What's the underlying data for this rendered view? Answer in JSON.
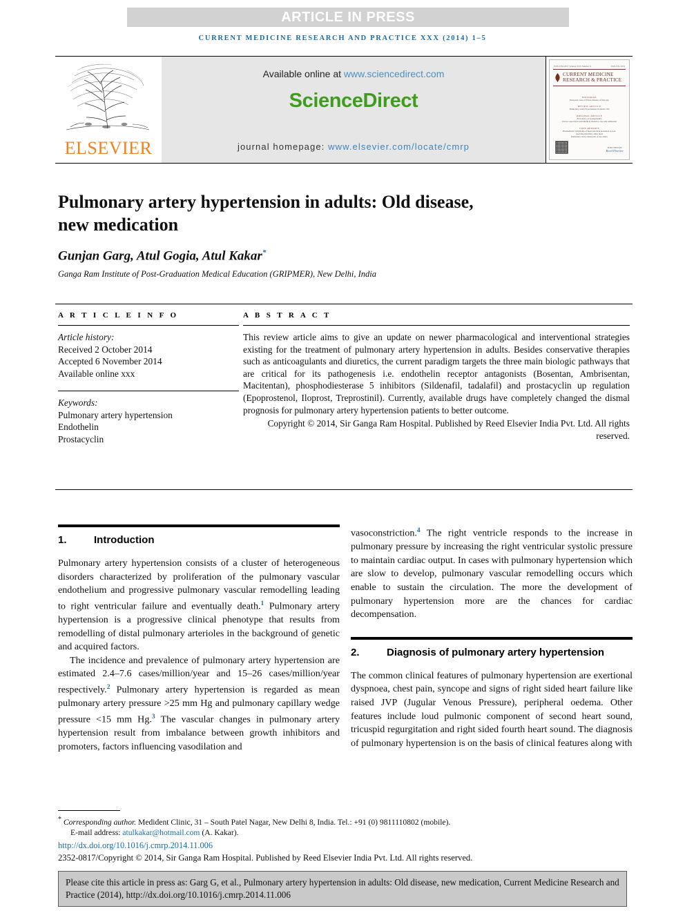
{
  "banner": {
    "article_in_press": "ARTICLE IN PRESS"
  },
  "running_head": "CURRENT MEDICINE RESEARCH AND PRACTICE XXX (2014) 1–5",
  "masthead": {
    "publisher_logo_text": "ELSEVIER",
    "available_prefix": "Available online at ",
    "available_url": "www.sciencedirect.com",
    "sciencedirect_logo": "ScienceDirect",
    "homepage_prefix": "journal homepage: ",
    "homepage_url": "www.elsevier.com/locate/cmrp",
    "cover": {
      "issn_left": "ISSN 2352-0817  Volume XXX  Number X",
      "issn_right": "XXX-XX, 2014",
      "title_line1": "CURRENT MEDICINE",
      "title_line2": "RESEARCH & PRACTICE",
      "imprint_label": "SGRH",
      "sections": [
        {
          "heading": "EDITORIAL",
          "lines": [
            "European cases of Ebola disease: A first step"
          ]
        },
        {
          "heading": "REVIEW ARTICLE",
          "lines": [
            "Pulmonary artery hypertension in adults: Old"
          ]
        },
        {
          "heading": "ORIGINAL ARTICLE",
          "lines": [
            "Prevalence of dyslipidaemia",
            "Factors associated with MDR in intensive care unit admission"
          ]
        },
        {
          "heading": "CASE REPORTS",
          "lines": [
            "Plasmablastic lymphoma of head and neck presented as non-",
            "resolving maxillary sinus mass",
            "Pulmonary artery aneurysm: A rare entity"
          ]
        }
      ],
      "publisher_small": "PUBLISHED BY",
      "publisher_name": "Reed Elsevier"
    }
  },
  "article": {
    "title": "Pulmonary artery hypertension in adults: Old disease, new medication",
    "authors": "Gunjan Garg, Atul Gogia, Atul Kakar",
    "author_marker": "*",
    "affiliation": "Ganga Ram Institute of Post-Graduation Medical Education (GRIPMER), New Delhi, India"
  },
  "article_info": {
    "label": "A R T I C L E   I N F O",
    "history_label": "Article history:",
    "history": [
      "Received 2 October 2014",
      "Accepted 6 November 2014",
      "Available online xxx"
    ],
    "keywords_label": "Keywords:",
    "keywords": [
      "Pulmonary artery hypertension",
      "Endothelin",
      "Prostacyclin"
    ]
  },
  "abstract": {
    "label": "A B S T R A C T",
    "body": "This review article aims to give an update on newer pharmacological and interventional strategies existing for the treatment of pulmonary artery hypertension in adults. Besides conservative therapies such as anticoagulants and diuretics, the current paradigm targets the three main biologic pathways that are critical for its pathogenesis i.e. endothelin receptor antagonists (Bosentan, Ambrisentan, Macitentan), phosphodiesterase 5 inhibitors (Sildenafil, tadalafil) and prostacyclin up regulation (Epoprostenol, Iloprost, Treprostinil). Currently, available drugs have completely changed the dismal prognosis for pulmonary artery hypertension patients to better outcome.",
    "copyright": "Copyright © 2014, Sir Ganga Ram Hospital. Published by Reed Elsevier India Pvt. Ltd. All rights reserved."
  },
  "sections": {
    "introduction": {
      "number": "1.",
      "title": "Introduction",
      "p1_a": "Pulmonary artery hypertension consists of a cluster of heterogeneous disorders characterized by proliferation of the pulmonary vascular endothelium and progressive pulmonary vascular remodelling leading to right ventricular failure and eventually death.",
      "p1_ref": "1",
      "p1_b": " Pulmonary artery hypertension is a progressive clinical phenotype that results from remodelling of distal pulmonary arterioles in the background of genetic and acquired factors.",
      "p2_a": "The incidence and prevalence of pulmonary artery hypertension are estimated 2.4–7.6 cases/million/year and 15–26 cases/million/year respectively.",
      "p2_ref": "2",
      "p2_b": " Pulmonary artery hypertension is regarded as mean pulmonary artery pressure >25 mm Hg and pulmonary capillary wedge pressure <15 mm Hg.",
      "p2_ref2": "3",
      "p2_c": " The vascular changes in pulmonary artery hypertension result from imbalance between growth inhibitors and promoters, factors influencing vasodilation and"
    },
    "right_lead": {
      "a": "vasoconstriction.",
      "ref": "4",
      "b": " The right ventricle responds to the increase in pulmonary pressure by increasing the right ventricular systolic pressure to maintain cardiac output. In cases with pulmonary hypertension which are slow to develop, pulmonary vascular remodelling occurs which enable to sustain the circulation. The more the development of pulmonary hypertension more are the chances for cardiac decompensation."
    },
    "diagnosis": {
      "number": "2.",
      "title": "Diagnosis of pulmonary artery hypertension",
      "p1": "The common clinical features of pulmonary hypertension are exertional dyspnoea, chest pain, syncope and signs of right sided heart failure like raised JVP (Jugular Venous Pressure), peripheral oedema. Other features include loud pulmonic component of second heart sound, tricuspid regurgitation and right sided fourth heart sound. The diagnosis of pulmonary hypertension is on the basis of clinical features along with"
    }
  },
  "footnote": {
    "star": "*",
    "corresponding_label": "Corresponding author.",
    "corresponding_rest": " Medident Clinic, 31 – South Patel Nagar, New Delhi 8, India. Tel.: +91 (0) 9811110802 (mobile).",
    "email_label": "E-mail address: ",
    "email": "atulkakar@hotmail.com",
    "email_suffix": " (A. Kakar).",
    "doi": "http://dx.doi.org/10.1016/j.cmrp.2014.11.006",
    "issn_copyright": "2352-0817/Copyright © 2014, Sir Ganga Ram Hospital. Published by Reed Elsevier India Pvt. Ltd. All rights reserved."
  },
  "cite_box": {
    "text": "Please cite this article in press as: Garg G, et al., Pulmonary artery hypertension in adults: Old disease, new medication, Current Medicine Research and Practice (2014), http://dx.doi.org/10.1016/j.cmrp.2014.11.006"
  },
  "colors": {
    "banner_bg": "#d2d2d2",
    "journal_blue": "#1a6ca8",
    "sciencedirect_green": "#3f9c1e",
    "elsevier_orange": "#f0821e",
    "link_blue": "#4a90c4",
    "cite_bg": "#c9c9c9"
  }
}
